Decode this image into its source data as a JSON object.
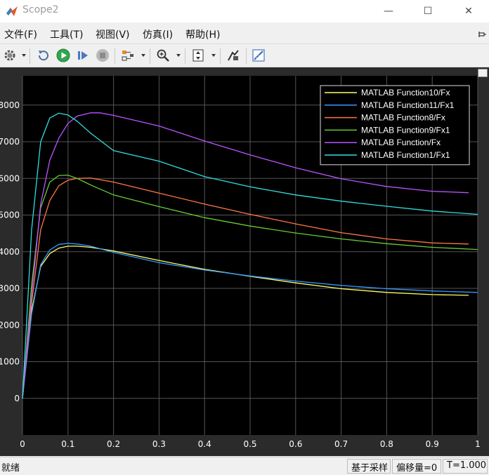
{
  "window": {
    "title": "Scope2",
    "minimize_glyph": "—",
    "maximize_glyph": "☐",
    "close_glyph": "✕"
  },
  "menu": [
    {
      "label": "文件(F)"
    },
    {
      "label": "工具(T)"
    },
    {
      "label": "视图(V)"
    },
    {
      "label": "仿真(I)"
    },
    {
      "label": "帮助(H)"
    }
  ],
  "toolbar": {
    "icons": [
      "gear-icon",
      "restore-view-icon",
      "run-icon",
      "step-forward-icon",
      "stop-icon",
      "signal-select-icon",
      "zoom-icon",
      "autoscale-icon",
      "style-icon",
      "measurements-icon"
    ]
  },
  "status": {
    "text": "就绪",
    "sample_mode": "基于采样",
    "offset": "偏移量=0",
    "time": "T=1.000"
  },
  "colors": {
    "plot_background": "#000000",
    "frame_background": "#2b2b2b",
    "grid": "#555555",
    "tick_text": "#ffffff"
  },
  "chart_data": {
    "type": "line",
    "title": "",
    "xlabel": "",
    "ylabel": "",
    "xlim": [
      0,
      1
    ],
    "ylim": [
      -1000,
      8800
    ],
    "grid": true,
    "legend_position": "top-right",
    "x_ticks": [
      "0",
      "0.1",
      "0.2",
      "0.3",
      "0.4",
      "0.5",
      "0.6",
      "0.7",
      "0.8",
      "0.9",
      "1"
    ],
    "x_tick_values": [
      0,
      0.1,
      0.2,
      0.3,
      0.4,
      0.5,
      0.6,
      0.7,
      0.8,
      0.9,
      1
    ],
    "y_ticks": [
      "0",
      "1000",
      "2000",
      "3000",
      "4000",
      "5000",
      "6000",
      "7000",
      "8000"
    ],
    "y_tick_values": [
      0,
      1000,
      2000,
      3000,
      4000,
      5000,
      6000,
      7000,
      8000
    ],
    "series": [
      {
        "name": "MATLAB Function10/Fx",
        "color": "#ffff66",
        "x": [
          0,
          0.02,
          0.04,
          0.06,
          0.08,
          0.1,
          0.12,
          0.15,
          0.2,
          0.3,
          0.4,
          0.5,
          0.6,
          0.7,
          0.8,
          0.9,
          0.98
        ],
        "y": [
          0,
          2400,
          3600,
          3950,
          4100,
          4150,
          4150,
          4120,
          4020,
          3760,
          3520,
          3330,
          3150,
          2990,
          2890,
          2830,
          2810
        ]
      },
      {
        "name": "MATLAB Function11/Fx1",
        "color": "#3399ff",
        "x": [
          0,
          0.02,
          0.04,
          0.06,
          0.08,
          0.1,
          0.12,
          0.15,
          0.2,
          0.3,
          0.4,
          0.5,
          0.6,
          0.7,
          0.8,
          0.9,
          1.0
        ],
        "y": [
          0,
          2300,
          3650,
          4050,
          4200,
          4230,
          4210,
          4150,
          3980,
          3700,
          3500,
          3340,
          3200,
          3080,
          2990,
          2930,
          2890
        ]
      },
      {
        "name": "MATLAB Function8/Fx",
        "color": "#ff7744",
        "x": [
          0,
          0.02,
          0.04,
          0.06,
          0.08,
          0.1,
          0.12,
          0.15,
          0.2,
          0.3,
          0.4,
          0.5,
          0.6,
          0.7,
          0.8,
          0.9,
          0.98
        ],
        "y": [
          0,
          2600,
          4600,
          5400,
          5800,
          5950,
          6000,
          6010,
          5900,
          5600,
          5300,
          5020,
          4760,
          4520,
          4350,
          4240,
          4210
        ]
      },
      {
        "name": "MATLAB Function9/Fx1",
        "color": "#66cc33",
        "x": [
          0,
          0.02,
          0.04,
          0.06,
          0.08,
          0.1,
          0.12,
          0.15,
          0.2,
          0.3,
          0.4,
          0.5,
          0.6,
          0.7,
          0.8,
          0.9,
          1.0
        ],
        "y": [
          0,
          3100,
          5200,
          5900,
          6080,
          6090,
          6000,
          5820,
          5550,
          5230,
          4930,
          4700,
          4510,
          4350,
          4220,
          4120,
          4060
        ]
      },
      {
        "name": "MATLAB Function/Fx",
        "color": "#bb55ff",
        "x": [
          0,
          0.02,
          0.04,
          0.06,
          0.08,
          0.1,
          0.12,
          0.15,
          0.17,
          0.2,
          0.3,
          0.4,
          0.5,
          0.6,
          0.7,
          0.8,
          0.9,
          0.98
        ],
        "y": [
          0,
          2800,
          5300,
          6500,
          7100,
          7500,
          7700,
          7790,
          7790,
          7720,
          7430,
          7020,
          6640,
          6290,
          5990,
          5780,
          5650,
          5610
        ]
      },
      {
        "name": "MATLAB Function1/Fx1",
        "color": "#33dddd",
        "x": [
          0,
          0.02,
          0.04,
          0.06,
          0.08,
          0.1,
          0.12,
          0.15,
          0.2,
          0.3,
          0.4,
          0.5,
          0.6,
          0.7,
          0.8,
          0.9,
          1.0
        ],
        "y": [
          0,
          4600,
          7000,
          7650,
          7780,
          7730,
          7560,
          7230,
          6760,
          6470,
          6050,
          5770,
          5550,
          5380,
          5240,
          5110,
          5020
        ]
      }
    ]
  }
}
